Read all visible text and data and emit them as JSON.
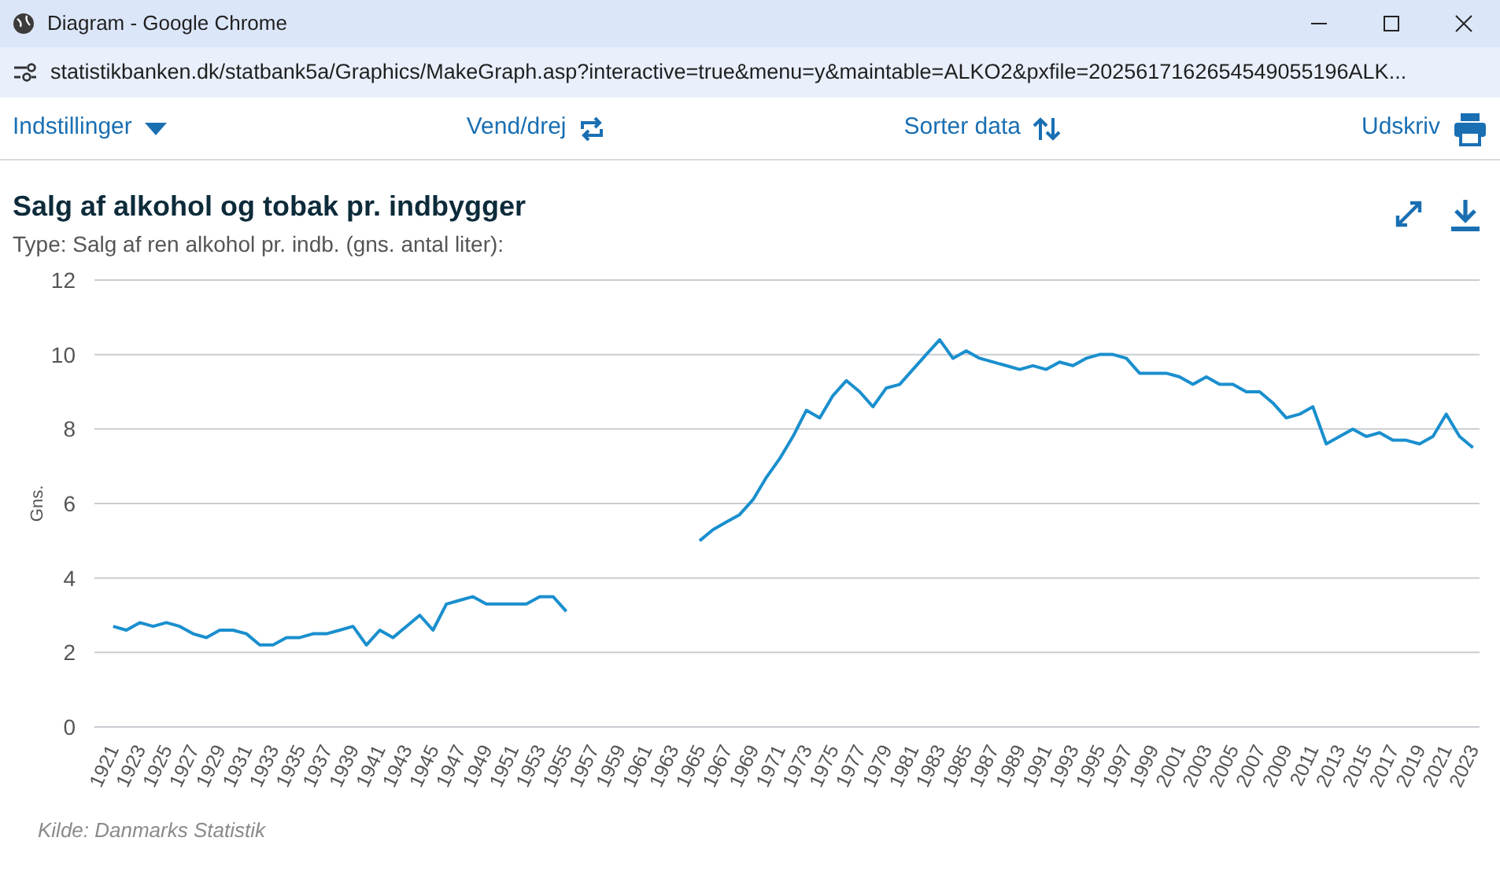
{
  "window": {
    "title": "Diagram - Google Chrome"
  },
  "address_bar": {
    "url": "statistikbanken.dk/statbank5a/Graphics/MakeGraph.asp?interactive=true&menu=y&maintable=ALKO2&pxfile=2025617162654549055196ALK..."
  },
  "toolbar": [
    {
      "label": "Indstillinger",
      "kind": "dropdown"
    },
    {
      "label": "Vend/drej",
      "kind": "rotate"
    },
    {
      "label": "Sorter data",
      "kind": "sort"
    },
    {
      "label": "Udskriv",
      "kind": "print"
    }
  ],
  "chart": {
    "title": "Salg af alkohol og tobak pr. indbygger",
    "subtitle": "Type: Salg af ren alkohol pr. indb. (gns. antal liter):",
    "chart_data": {
      "type": "line",
      "ylabel": "Gns.",
      "grid": true,
      "xlim": [
        1919.6,
        2023.5
      ],
      "ylim": [
        0,
        12
      ],
      "yticks": [
        0,
        2,
        4,
        6,
        8,
        10,
        12
      ],
      "x": [
        1921,
        1922,
        1923,
        1924,
        1925,
        1926,
        1927,
        1928,
        1929,
        1930,
        1931,
        1932,
        1933,
        1934,
        1935,
        1936,
        1937,
        1938,
        1939,
        1940,
        1941,
        1942,
        1943,
        1944,
        1945,
        1946,
        1947,
        1948,
        1949,
        1950,
        1951,
        1952,
        1953,
        1954,
        1955,
        1956,
        1957,
        1958,
        1959,
        1960,
        1961,
        1962,
        1963,
        1964,
        1965,
        1966,
        1967,
        1968,
        1969,
        1970,
        1971,
        1972,
        1973,
        1974,
        1975,
        1976,
        1977,
        1978,
        1979,
        1980,
        1981,
        1982,
        1983,
        1984,
        1985,
        1986,
        1987,
        1988,
        1989,
        1990,
        1991,
        1992,
        1993,
        1994,
        1995,
        1996,
        1997,
        1998,
        1999,
        2000,
        2001,
        2002,
        2003,
        2004,
        2005,
        2006,
        2007,
        2008,
        2009,
        2010,
        2011,
        2012,
        2013,
        2014,
        2015,
        2016,
        2017,
        2018,
        2019,
        2020,
        2021,
        2022,
        2023
      ],
      "xticks": [
        1921,
        1923,
        1925,
        1927,
        1929,
        1931,
        1933,
        1935,
        1937,
        1939,
        1941,
        1943,
        1945,
        1947,
        1949,
        1951,
        1953,
        1955,
        1957,
        1959,
        1961,
        1963,
        1965,
        1967,
        1969,
        1971,
        1973,
        1975,
        1977,
        1979,
        1981,
        1983,
        1985,
        1987,
        1989,
        1991,
        1993,
        1995,
        1997,
        1999,
        2001,
        2003,
        2005,
        2007,
        2009,
        2011,
        2013,
        2015,
        2017,
        2019,
        2021,
        2023
      ],
      "series": [
        {
          "color": "#1a8fce",
          "values": [
            2.7,
            2.6,
            2.8,
            2.7,
            2.8,
            2.7,
            2.5,
            2.4,
            2.6,
            2.6,
            2.5,
            2.2,
            2.2,
            2.4,
            2.4,
            2.5,
            2.5,
            2.6,
            2.7,
            2.2,
            2.6,
            2.4,
            2.7,
            3.0,
            2.6,
            3.3,
            3.4,
            3.5,
            3.3,
            3.3,
            3.3,
            3.3,
            3.5,
            3.5,
            3.1,
            null,
            null,
            null,
            null,
            null,
            null,
            null,
            null,
            null,
            5.0,
            5.3,
            5.5,
            5.7,
            6.1,
            6.7,
            7.2,
            7.8,
            8.5,
            8.3,
            8.9,
            9.3,
            9.0,
            8.6,
            9.1,
            9.2,
            9.6,
            10.0,
            10.4,
            9.9,
            10.1,
            9.9,
            9.8,
            9.7,
            9.6,
            9.7,
            9.6,
            9.8,
            9.7,
            9.9,
            10.0,
            10.0,
            9.9,
            9.5,
            9.5,
            9.5,
            9.4,
            9.2,
            9.4,
            9.2,
            9.2,
            9.0,
            9.0,
            8.7,
            8.3,
            8.4,
            8.6,
            7.6,
            7.8,
            8.0,
            7.8,
            7.9,
            7.7,
            7.7,
            7.6,
            7.8,
            8.4,
            7.8,
            7.5
          ]
        }
      ]
    },
    "source": "Kilde: Danmarks Statistik"
  }
}
